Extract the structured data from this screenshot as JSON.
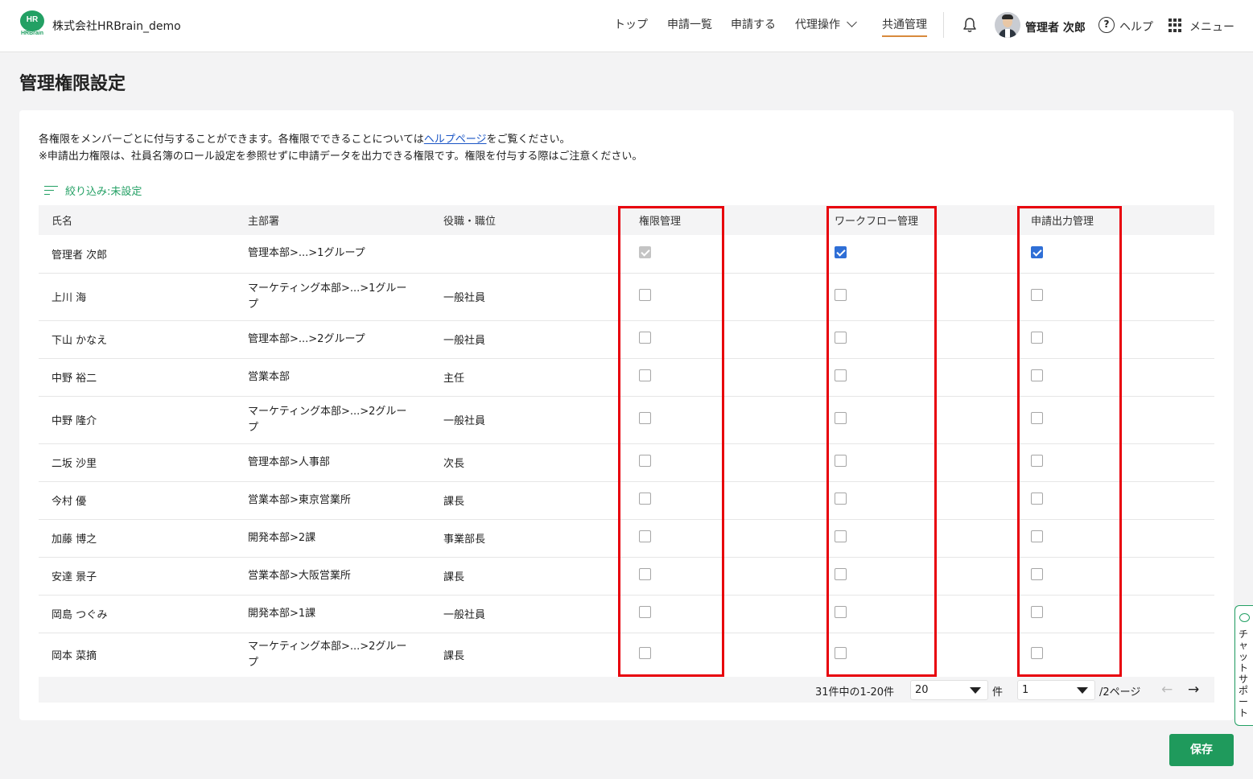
{
  "header": {
    "logo_text": "HR",
    "logo_sub": "HRBrain",
    "company": "株式会社HRBrain_demo",
    "nav": {
      "top": "トップ",
      "list": "申請一覧",
      "apply": "申請する",
      "proxy": "代理操作",
      "common": "共通管理"
    },
    "user_name": "管理者 次郎",
    "help": "ヘルプ",
    "menu": "メニュー"
  },
  "page": {
    "title": "管理権限設定",
    "desc_line1_pre": "各権限をメンバーごとに付与することができます。各権限でできることについては",
    "desc_link": "ヘルプページ",
    "desc_line1_post": "をご覧ください。",
    "desc_line2": "※申請出力権限は、社員名簿のロール設定を参照せずに申請データを出力できる権限です。権限を付与する際はご注意ください。",
    "filter": "絞り込み:未設定"
  },
  "table": {
    "headers": {
      "name": "氏名",
      "dept": "主部署",
      "position": "役職・職位",
      "perm_admin": "権限管理",
      "workflow_admin": "ワークフロー管理",
      "output_admin": "申請出力管理"
    },
    "rows": [
      {
        "name": "管理者 次郎",
        "dept": "管理本部>...>1グループ",
        "position": "",
        "perm": "disabled",
        "workflow": "checked",
        "output": "checked"
      },
      {
        "name": "上川 海",
        "dept": "マーケティング本部>...>1グループ",
        "position": "一般社員",
        "perm": "unchecked",
        "workflow": "unchecked",
        "output": "unchecked"
      },
      {
        "name": "下山 かなえ",
        "dept": "管理本部>...>2グループ",
        "position": "一般社員",
        "perm": "unchecked",
        "workflow": "unchecked",
        "output": "unchecked"
      },
      {
        "name": "中野 裕二",
        "dept": "営業本部",
        "position": "主任",
        "perm": "unchecked",
        "workflow": "unchecked",
        "output": "unchecked"
      },
      {
        "name": "中野 隆介",
        "dept": "マーケティング本部>...>2グループ",
        "position": "一般社員",
        "perm": "unchecked",
        "workflow": "unchecked",
        "output": "unchecked"
      },
      {
        "name": "二坂 沙里",
        "dept": "管理本部>人事部",
        "position": "次長",
        "perm": "unchecked",
        "workflow": "unchecked",
        "output": "unchecked"
      },
      {
        "name": "今村 優",
        "dept": "営業本部>東京営業所",
        "position": "課長",
        "perm": "unchecked",
        "workflow": "unchecked",
        "output": "unchecked"
      },
      {
        "name": "加藤 博之",
        "dept": "開発本部>2課",
        "position": "事業部長",
        "perm": "unchecked",
        "workflow": "unchecked",
        "output": "unchecked"
      },
      {
        "name": "安達 景子",
        "dept": "営業本部>大阪営業所",
        "position": "課長",
        "perm": "unchecked",
        "workflow": "unchecked",
        "output": "unchecked"
      },
      {
        "name": "岡島 つぐみ",
        "dept": "開発本部>1課",
        "position": "一般社員",
        "perm": "unchecked",
        "workflow": "unchecked",
        "output": "unchecked"
      },
      {
        "name": "岡本 菜摘",
        "dept": "マーケティング本部>...>2グループ",
        "position": "課長",
        "perm": "unchecked",
        "workflow": "unchecked",
        "output": "unchecked"
      }
    ]
  },
  "pager": {
    "info": "31件中の1-20件",
    "per_page": "20",
    "per_page_unit": "件",
    "page": "1",
    "page_total": "/2ページ",
    "prev": "←",
    "next": "→"
  },
  "save": "保存",
  "chat": "チャットサポート",
  "colors": {
    "brand_green": "#23a064",
    "save_green": "#1f9a5c",
    "highlight_red": "#e8000b",
    "checkbox_blue": "#2f6fd6"
  }
}
